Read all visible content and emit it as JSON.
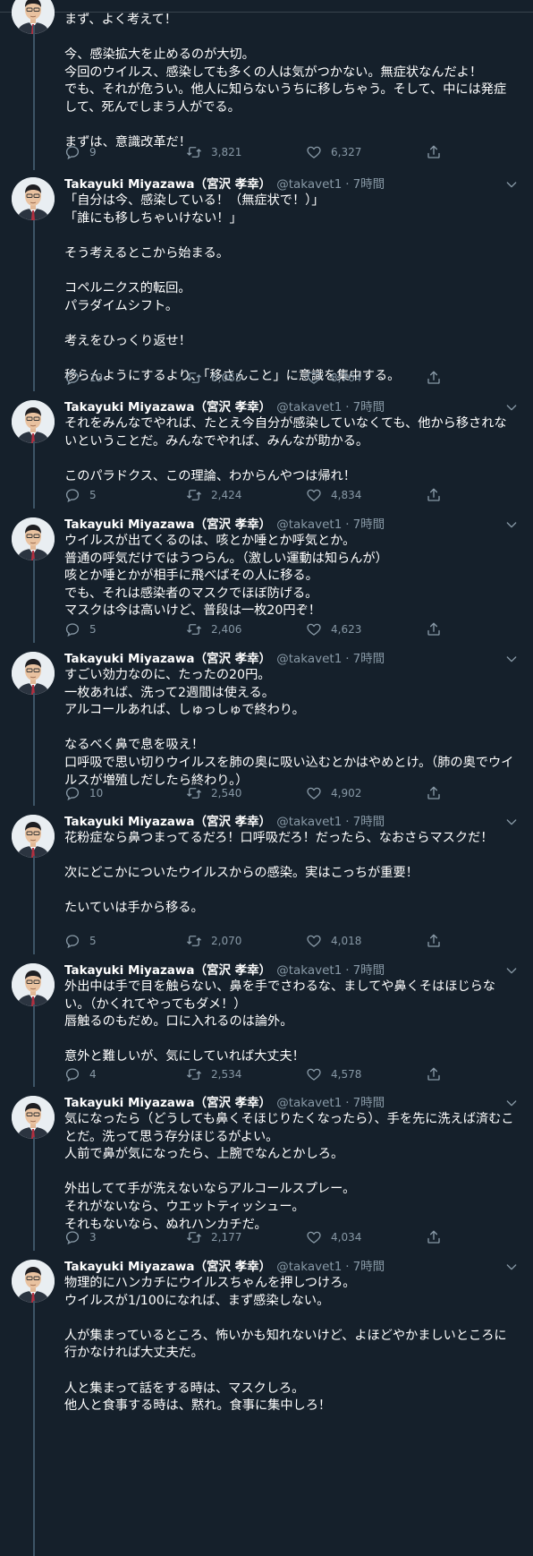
{
  "author": {
    "name": "Takayuki Miyazawa（宮沢 孝幸）",
    "handle": "@takavet1",
    "separator": "·",
    "time": "7時間"
  },
  "icons": {
    "reply": "reply-icon",
    "retweet": "retweet-icon",
    "like": "heart-icon",
    "share": "share-icon",
    "more": "chevron-down-icon"
  },
  "colors": {
    "background": "#15202b",
    "muted": "#8899a6",
    "divider": "#38444d"
  },
  "tweets": [
    {
      "text": "まず、よく考えて！\n\n今、感染拡大を止めるのが大切。\n今回のウイルス、感染しても多くの人は気がつかない。無症状なんだよ！\nでも、それが危うい。他人に知らないうちに移しちゃう。そして、中には発症して、死んでしまう人がでる。\n\nまずは、意識改革だ！",
      "replies": "9",
      "retweets": "3,821",
      "likes": "6,327"
    },
    {
      "text": "「自分は今、感染している！（無症状で！）」\n「誰にも移しちゃいけない！」\n\nそう考えるとこから始まる。\n\nコペルニクス的転回。\nパラダイムシフト。\n\n考えをひっくり返せ！\n\n移らんようにするより、「移さんこと」に意識を集中する。",
      "replies": "13",
      "retweets": "6,065",
      "likes": "8,764"
    },
    {
      "text": "それをみんなでやれば、たとえ今自分が感染していなくても、他から移されないということだ。みんなでやれば、みんなが助かる。\n\nこのパラドクス、この理論、わからんやつは帰れ！",
      "replies": "5",
      "retweets": "2,424",
      "likes": "4,834"
    },
    {
      "text": "ウイルスが出てくるのは、咳とか唾とか呼気とか。\n普通の呼気だけではうつらん。（激しい運動は知らんが）\n咳とか唾とかが相手に飛べばその人に移る。\nでも、それは感染者のマスクでほぼ防げる。\nマスクは今は高いけど、普段は一枚20円ぞ！",
      "replies": "5",
      "retweets": "2,406",
      "likes": "4,623"
    },
    {
      "text": "すごい効力なのに、たったの20円。\n一枚あれば、洗って2週間は使える。\nアルコールあれば、しゅっしゅで終わり。\n\nなるべく鼻で息を吸え！\n口呼吸で思い切りウイルスを肺の奥に吸い込むとかはやめとけ。（肺の奥でウイルスが増殖しだしたら終わり。）",
      "replies": "10",
      "retweets": "2,540",
      "likes": "4,902"
    },
    {
      "text": "花粉症なら鼻つまってるだろ！口呼吸だろ！だったら、なおさらマスクだ！\n\n次にどこかについたウイルスからの感染。実はこっちが重要！\n\nたいていは手から移る。",
      "replies": "5",
      "retweets": "2,070",
      "likes": "4,018"
    },
    {
      "text": "外出中は手で目を触らない、鼻を手でさわるな、ましてや鼻くそはほじらない。（かくれてやってもダメ！）\n唇触るのもだめ。口に入れるのは論外。\n\n意外と難しいが、気にしていれば大丈夫！",
      "replies": "4",
      "retweets": "2,534",
      "likes": "4,578"
    },
    {
      "text": "気になったら（どうしても鼻くそほじりたくなったら）、手を先に洗えば済むことだ。洗って思う存分ほじるがよい。\n人前で鼻が気になったら、上腕でなんとかしろ。\n\n外出してて手が洗えないならアルコールスプレー。\nそれがないなら、ウエットティッシュー。\nそれもないなら、ぬれハンカチだ。",
      "replies": "3",
      "retweets": "2,177",
      "likes": "4,034"
    },
    {
      "text": "物理的にハンカチにウイルスちゃんを押しつけろ。\nウイルスが1/100になれば、まず感染しない。\n\n人が集まっているところ、怖いかも知れないけど、よほどやかましいところに行かなければ大丈夫だ。\n\n人と集まって話をする時は、マスクしろ。\n他人と食事する時は、黙れ。食事に集中しろ！",
      "replies": "",
      "retweets": "",
      "likes": ""
    }
  ]
}
